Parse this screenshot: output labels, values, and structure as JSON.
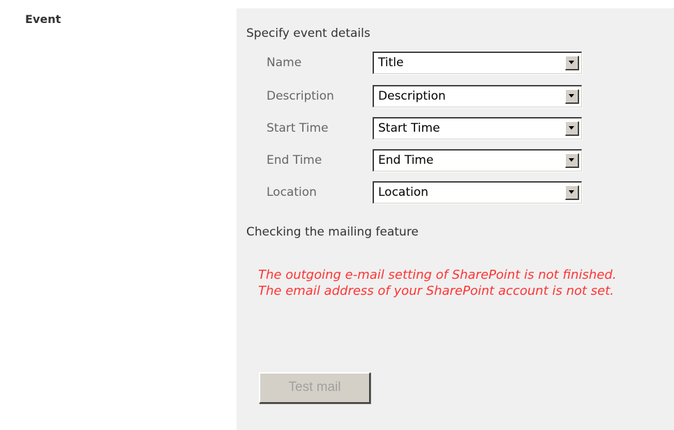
{
  "section": {
    "title": "Event"
  },
  "panel": {
    "heading": "Specify event details",
    "fields": [
      {
        "label": "Name",
        "value": "Title"
      },
      {
        "label": "Description",
        "value": "Description"
      },
      {
        "label": "Start Time",
        "value": "Start Time"
      },
      {
        "label": "End Time",
        "value": "End Time"
      },
      {
        "label": "Location",
        "value": "Location"
      }
    ],
    "mailing": {
      "heading": "Checking the mailing feature",
      "errors": [
        "The outgoing e-mail setting of SharePoint is not finished.",
        "The email address of your SharePoint account is not set."
      ],
      "test_button_label": "Test mail",
      "test_button_enabled": false
    }
  },
  "colors": {
    "panel_background": "#f0f0f0",
    "error_text": "#ff3333",
    "button_face": "#d4d0c8",
    "button_disabled_text": "#a0a0a0"
  },
  "icons": {
    "dropdown": "chevron-down-icon"
  }
}
